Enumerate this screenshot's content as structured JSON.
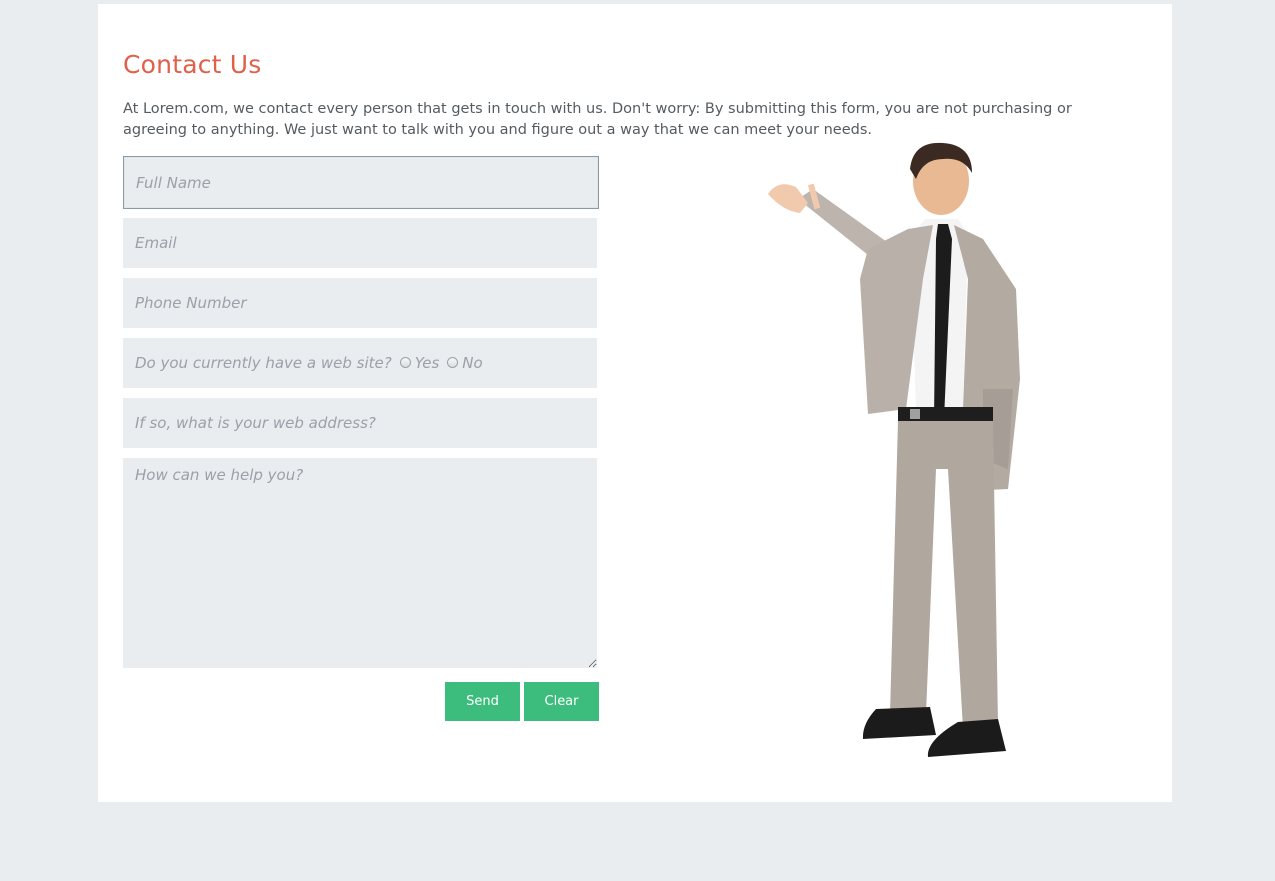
{
  "page": {
    "title": "Contact Us",
    "intro": "At Lorem.com, we contact every person that gets in touch with us. Don't worry: By submitting this form, you are not purchasing or agreeing to anything. We just want to talk with you and figure out a way that we can meet your needs."
  },
  "form": {
    "full_name": {
      "placeholder": "Full Name",
      "value": ""
    },
    "email": {
      "placeholder": "Email",
      "value": ""
    },
    "phone": {
      "placeholder": "Phone Number",
      "value": ""
    },
    "website_question": {
      "label": "Do you currently have a web site?",
      "options": [
        "Yes",
        "No"
      ],
      "selected": ""
    },
    "web_address": {
      "placeholder": "If so, what is your web address?",
      "value": ""
    },
    "message": {
      "placeholder": "How can we help you?",
      "value": ""
    },
    "send_label": "Send",
    "clear_label": "Clear"
  },
  "colors": {
    "title": "#e0604a",
    "button": "#3dbd7d",
    "field_bg": "#e9edf0",
    "page_bg": "#e9edf0"
  },
  "image": {
    "icon": "businessman-presenting-illustration"
  }
}
